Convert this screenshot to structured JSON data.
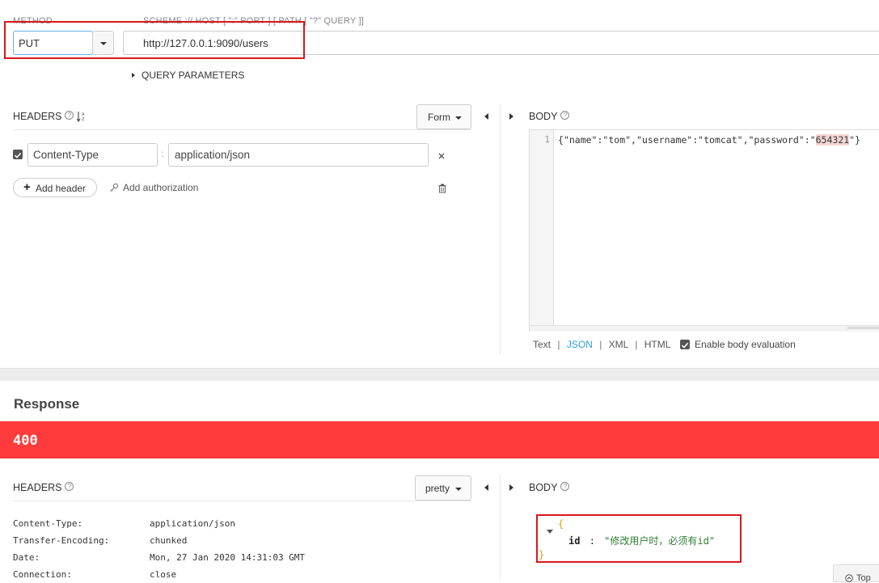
{
  "request": {
    "method_label": "METHOD",
    "url_label": "SCHEME :// HOST [ \":\" PORT ] [ PATH [ \"?\" QUERY ]]",
    "method_value": "PUT",
    "url_value": "http://127.0.0.1:9090/users",
    "query_parameters_label": "QUERY PARAMETERS"
  },
  "req_headers": {
    "title": "HEADERS",
    "mode_button": "Form",
    "items": [
      {
        "name": "Content-Type",
        "value": "application/json"
      }
    ],
    "add_header": "Add header",
    "add_authorization": "Add authorization"
  },
  "req_body": {
    "title": "BODY",
    "line_number": "1",
    "tokens": {
      "open": "{",
      "k1": "\"name\"",
      "colon": ":",
      "v1": "\"tom\"",
      "comma": ",",
      "k2": "\"username\"",
      "v2": "\"tomcat\"",
      "k3": "\"password\"",
      "q": "\"",
      "v3": "654321",
      "close": "}"
    },
    "formats": {
      "text": "Text",
      "json": "JSON",
      "xml": "XML",
      "html": "HTML",
      "sep": "|"
    },
    "active_format": "JSON",
    "enable_eval": "Enable body evaluation"
  },
  "response": {
    "title": "Response",
    "status": "400",
    "status_color": "#ff3b3b",
    "headers_title": "HEADERS",
    "pretty_button": "pretty",
    "headers": [
      {
        "name": "Content-Type:",
        "value": "application/json"
      },
      {
        "name": "Transfer-Encoding:",
        "value": "chunked"
      },
      {
        "name": "Date:",
        "value": "Mon, 27 Jan 2020 14:31:03 GMT"
      },
      {
        "name": "Connection:",
        "value": "close"
      }
    ],
    "body_title": "BODY",
    "body": {
      "open": "{",
      "key": "id",
      "colon": ":",
      "value": "\"修改用户时，必须有id\"",
      "close": "}"
    },
    "top_button": "Top"
  }
}
